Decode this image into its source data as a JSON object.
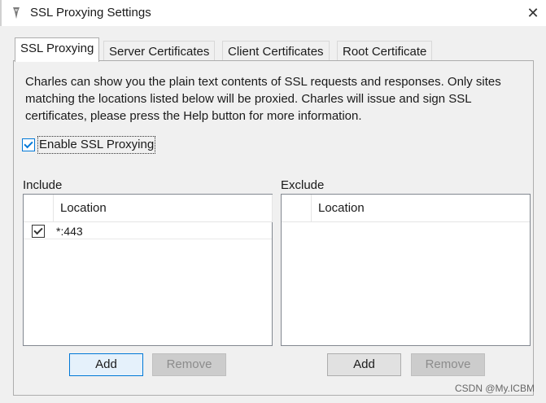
{
  "window": {
    "title": "SSL Proxying Settings",
    "close_glyph": "✕",
    "app_icon": "charles-app-icon"
  },
  "tabs": [
    {
      "label": "SSL Proxying",
      "active": true
    },
    {
      "label": "Server Certificates",
      "active": false
    },
    {
      "label": "Client Certificates",
      "active": false
    },
    {
      "label": "Root Certificate",
      "active": false
    }
  ],
  "panel": {
    "description": "Charles can show you the plain text contents of SSL requests and responses. Only sites matching the locations listed below will be proxied. Charles will issue and sign SSL certificates, please press the Help button for more information.",
    "enable_checkbox": {
      "label": "Enable SSL Proxying",
      "checked": true
    },
    "include": {
      "label": "Include",
      "column_header": "Location",
      "rows": [
        {
          "location": "*:443",
          "checked": true
        }
      ],
      "add_label": "Add",
      "remove_label": "Remove"
    },
    "exclude": {
      "label": "Exclude",
      "column_header": "Location",
      "rows": [],
      "add_label": "Add",
      "remove_label": "Remove"
    }
  },
  "watermark": "CSDN @My.ICBM",
  "colors": {
    "accent": "#0078d7",
    "dialog_bg": "#f0f0f0",
    "disabled_button": "#cccccc"
  }
}
